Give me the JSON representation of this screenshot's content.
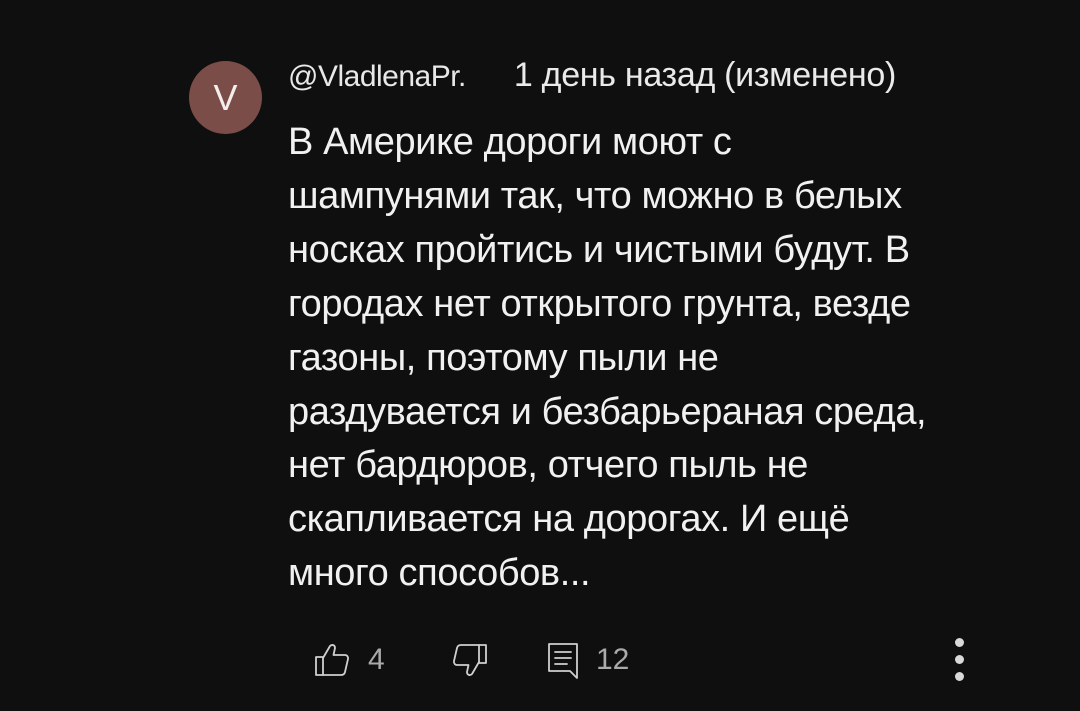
{
  "comment": {
    "avatar_letter": "V",
    "avatar_color": "#7b4d48",
    "author": "@VladlenaPr.",
    "timestamp": "1 день назад (изменено)",
    "text_lines": [
      "В Америке дороги моют с",
      "шампунями так, что можно в белых",
      "носках пройтись и чистыми будут. В",
      "городах нет открытого грунта, везде",
      "газоны, поэтому пыли не",
      "раздувается и безбарьераная среда,",
      "нет бардюров, отчего пыль не",
      "скапливается на дорогах. И ещё",
      "много способов..."
    ]
  },
  "actions": {
    "like_icon": "thumb-up-outline",
    "like_count": "4",
    "dislike_icon": "thumb-down-outline",
    "reply_icon": "comment-outline",
    "reply_count": "12",
    "more_icon": "vertical-ellipsis"
  },
  "theme": {
    "background": "#0f0f0f",
    "text": "#f1f1f1",
    "muted": "#aaaaaa"
  }
}
